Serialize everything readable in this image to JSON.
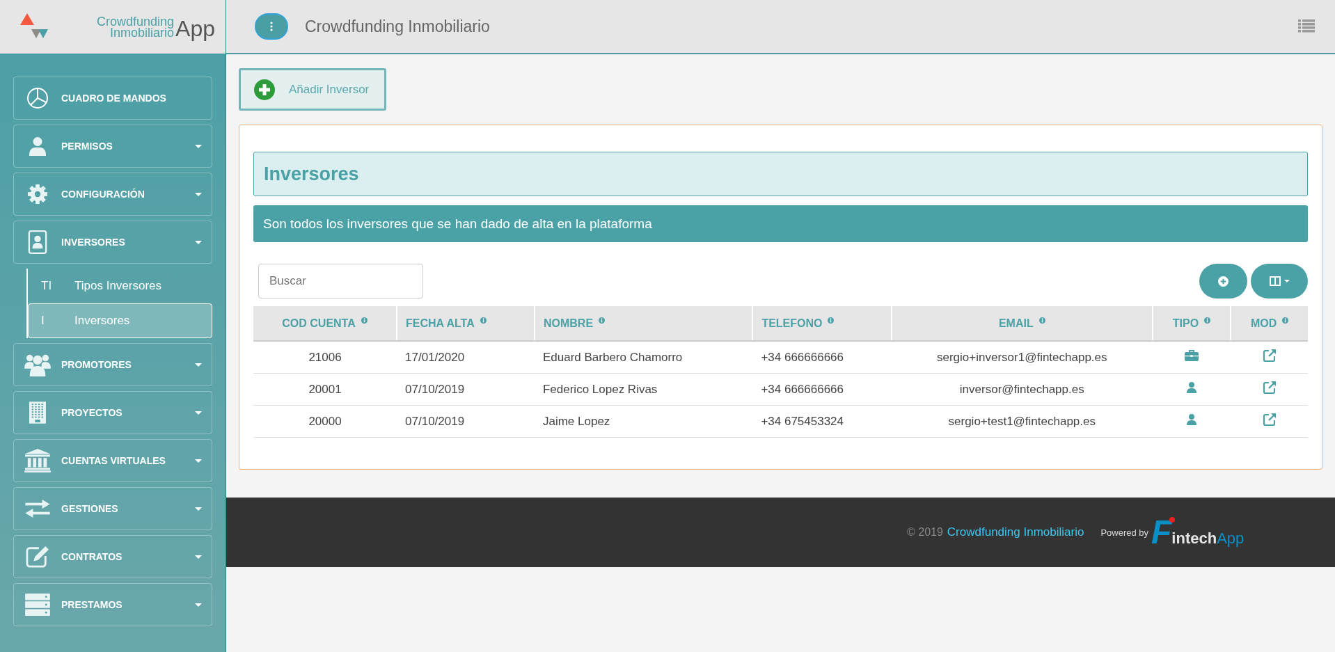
{
  "logo": {
    "line1": "Crowdfunding",
    "line2": "Inmobiliario",
    "suffix": "App"
  },
  "header": {
    "title": "Crowdfunding Inmobiliario"
  },
  "sidebar": {
    "items": [
      {
        "label": "CUADRO DE MANDOS",
        "expandable": false
      },
      {
        "label": "PERMISOS",
        "expandable": true
      },
      {
        "label": "CONFIGURACIÓN",
        "expandable": true
      },
      {
        "label": "INVERSORES",
        "expandable": true,
        "children": [
          {
            "abbr": "TI",
            "label": "Tipos Inversores",
            "selected": false
          },
          {
            "abbr": "I",
            "label": "Inversores",
            "selected": true
          }
        ]
      },
      {
        "label": "PROMOTORES",
        "expandable": true
      },
      {
        "label": "PROYECTOS",
        "expandable": true
      },
      {
        "label": "CUENTAS VIRTUALES",
        "expandable": true
      },
      {
        "label": "GESTIONES",
        "expandable": true
      },
      {
        "label": "CONTRATOS",
        "expandable": true
      },
      {
        "label": "PRESTAMOS",
        "expandable": true
      }
    ]
  },
  "add_button": {
    "label": "Añadir Inversor"
  },
  "panel": {
    "title": "Inversores",
    "description": "Son todos los inversores que se han dado de alta en la plataforma"
  },
  "search": {
    "placeholder": "Buscar"
  },
  "table": {
    "columns": [
      {
        "label": "COD CUENTA"
      },
      {
        "label": "FECHA ALTA"
      },
      {
        "label": "NOMBRE"
      },
      {
        "label": "TELEFONO"
      },
      {
        "label": "EMAIL"
      },
      {
        "label": "TIPO"
      },
      {
        "label": "MOD"
      }
    ],
    "rows": [
      {
        "code": "21006",
        "date": "17/01/2020",
        "name": "Eduard Barbero Chamorro",
        "phone": "+34 666666666",
        "email": "sergio+inversor1@fintechapp.es",
        "kind": "company"
      },
      {
        "code": "20001",
        "date": "07/10/2019",
        "name": "Federico Lopez Rivas",
        "phone": "+34 666666666",
        "email": "inversor@fintechapp.es",
        "kind": "person"
      },
      {
        "code": "20000",
        "date": "07/10/2019",
        "name": "Jaime Lopez",
        "phone": "+34 675453324",
        "email": "sergio+test1@fintechapp.es",
        "kind": "person"
      }
    ]
  },
  "footer": {
    "copyright": "© 2019",
    "link": "Crowdfunding Inmobiliario",
    "powered": "Powered by",
    "brand": {
      "initial": "F",
      "name": "intech",
      "suffix": "App"
    }
  }
}
